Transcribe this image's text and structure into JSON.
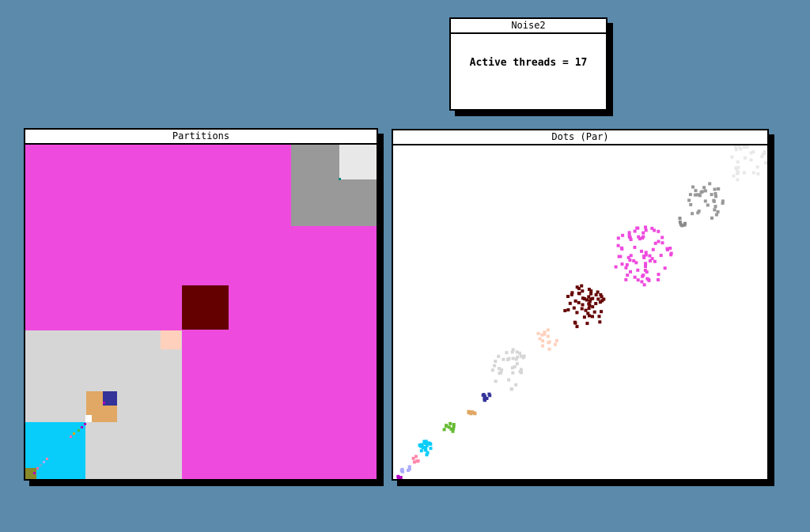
{
  "windows": {
    "noise": {
      "title": "Noise2",
      "status_text": "Active threads = 17"
    },
    "partitions": {
      "title": "Partitions"
    },
    "dots": {
      "title": "Dots (Par)"
    }
  },
  "colors": {
    "desktop": "#5b8aab",
    "magenta": "#ee4ade",
    "maroon": "#650000",
    "light_gray": "#d6d6d6",
    "mid_gray": "#999999",
    "very_light_gray": "#e8e8e8",
    "peach": "#ffd1bc",
    "tan": "#e1a764",
    "navy": "#333399",
    "cyan": "#08cdfa"
  }
}
